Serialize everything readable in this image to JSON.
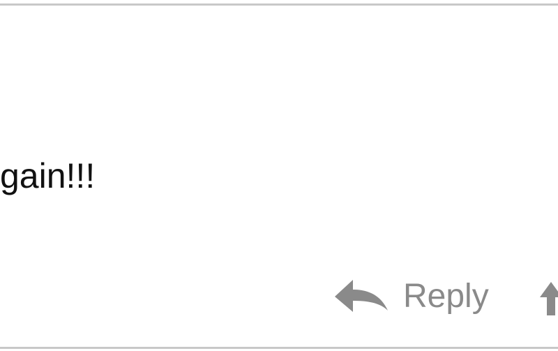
{
  "message": {
    "text": "gain!!!"
  },
  "actions": {
    "reply_label": "Reply",
    "reply_icon": "reply-arrow-icon",
    "next_icon": "up-arrow-icon"
  },
  "colors": {
    "border": "#c8c8c8",
    "text": "#111111",
    "action": "#8a8a8a"
  }
}
